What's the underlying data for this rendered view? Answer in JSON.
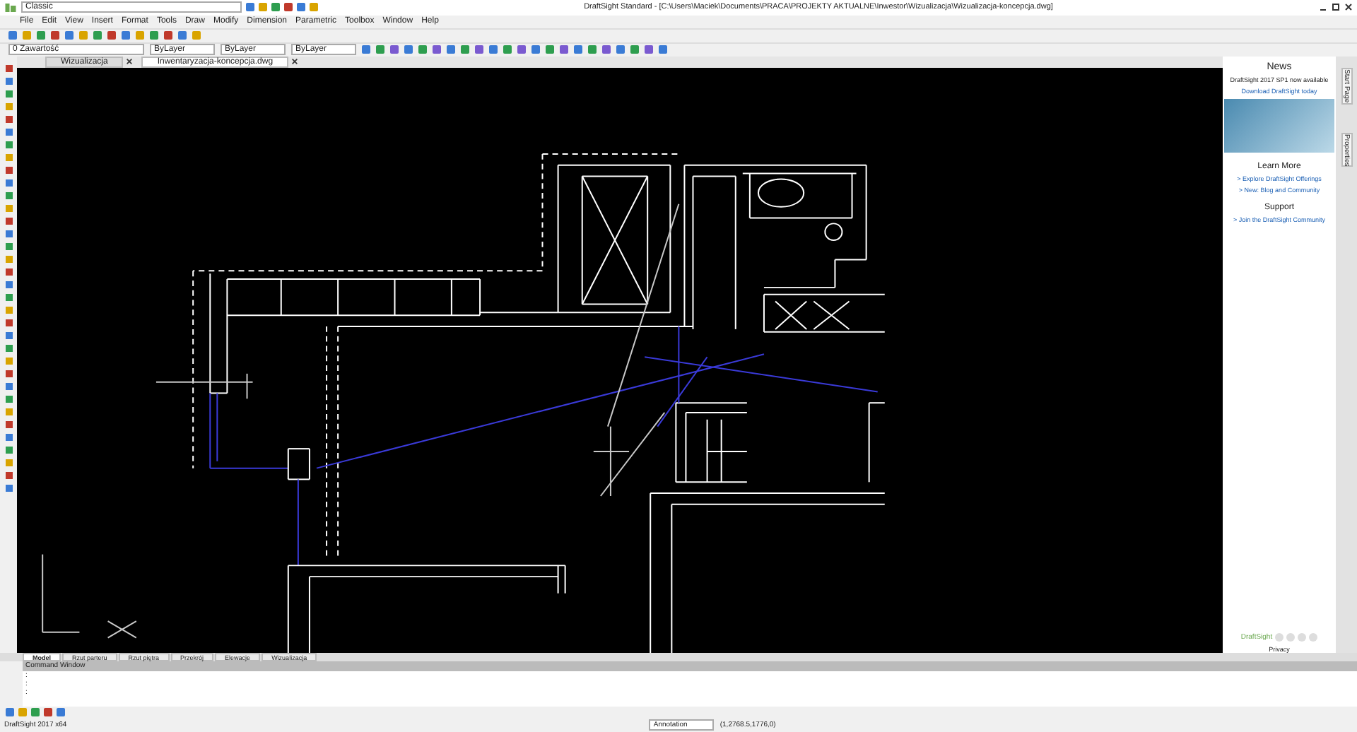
{
  "window": {
    "title": "DraftSight Standard - [C:\\Users\\Maciek\\Documents\\PRACA\\PROJEKTY AKTUALNE\\Inwestor\\Wizualizacja\\Wizualizacja-koncepcja.dwg]",
    "workspace": "Classic"
  },
  "menu": [
    "File",
    "Edit",
    "View",
    "Insert",
    "Format",
    "Tools",
    "Draw",
    "Modify",
    "Dimension",
    "Parametric",
    "Toolbox",
    "Window",
    "Help"
  ],
  "toolbar": {
    "combos": [
      "0 Zawartość",
      "ByLayer",
      "ByLayer",
      "ByLayer"
    ]
  },
  "document_tabs": [
    {
      "label": "Wizualizacja",
      "selected": false
    },
    {
      "label": "Inwentaryzacja-koncepcja.dwg",
      "selected": true
    }
  ],
  "layout_tabs": [
    {
      "label": "Model",
      "selected": true
    },
    {
      "label": "Rzut parteru",
      "selected": false
    },
    {
      "label": "Rzut piętra",
      "selected": false
    },
    {
      "label": "Przekrój",
      "selected": false
    },
    {
      "label": "Elewacje",
      "selected": false
    },
    {
      "label": "Wizualizacja",
      "selected": false
    }
  ],
  "command_window": {
    "title": "Command Window",
    "lines": [
      ":",
      ":",
      ":"
    ]
  },
  "news_panel": {
    "title": "News",
    "headline": "DraftSight 2017 SP1 now available",
    "link": "Download DraftSight today",
    "sections": [
      {
        "title": "Learn More",
        "links": [
          "> Explore DraftSight Offerings",
          "> New: Blog and Community"
        ]
      },
      {
        "title": "Support",
        "links": [
          "> Join the DraftSight Community"
        ]
      }
    ],
    "footer": "Privacy",
    "logo": "DraftSight",
    "side_tabs": [
      "Start Page",
      "Properties"
    ]
  },
  "status_bar": {
    "version": "DraftSight 2017 x64",
    "annotation": "Annotation",
    "coordinates": "(1,2768.5,1776,0)"
  }
}
